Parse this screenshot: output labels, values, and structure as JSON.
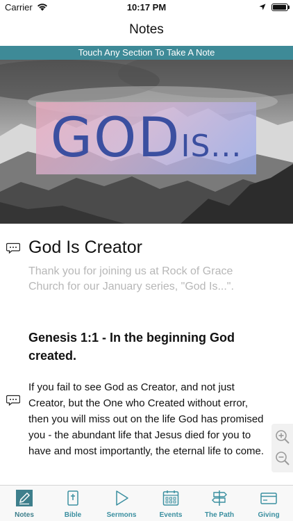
{
  "status_bar": {
    "carrier": "Carrier",
    "time": "10:17 PM",
    "battery_level": 0.95
  },
  "nav": {
    "title": "Notes"
  },
  "banner": {
    "text": "Touch Any Section To Take A Note"
  },
  "hero": {
    "word_main": "GOD",
    "word_secondary": "IS..."
  },
  "content": {
    "section_title": "God Is Creator",
    "intro": "Thank you for joining us at Rock of Grace Church for our January series, \"God Is...\".",
    "scripture": "Genesis 1:1 - In the beginning God created.",
    "body": "If you fail to see God as Creator, and not just Creator, but the One who Created without error, then you will miss out on the life God has promised you - the abundant life that Jesus died for you to have and most importantly, the eternal life to come."
  },
  "colors": {
    "accent": "#3e8a97",
    "tab_label": "#3b8fa0",
    "intro_text": "#b7b7b7"
  },
  "tabs": [
    {
      "label": "Notes",
      "icon": "notes-icon",
      "active": true
    },
    {
      "label": "Bible",
      "icon": "bible-icon",
      "active": false
    },
    {
      "label": "Sermons",
      "icon": "play-icon",
      "active": false
    },
    {
      "label": "Events",
      "icon": "calendar-icon",
      "active": false
    },
    {
      "label": "The Path",
      "icon": "signpost-icon",
      "active": false
    },
    {
      "label": "Giving",
      "icon": "card-icon",
      "active": false
    }
  ]
}
